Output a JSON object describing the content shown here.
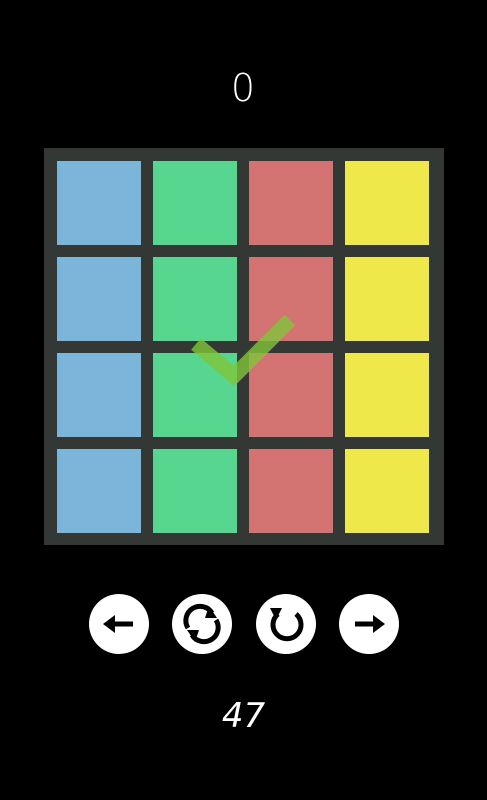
{
  "score": "0",
  "moves": "47",
  "colors": {
    "background": "#000000",
    "board": "#343834",
    "blue": "#7bb5d9",
    "green": "#57d68f",
    "red": "#d37372",
    "yellow": "#eee84a",
    "check": "#7fc63a"
  },
  "board": {
    "rows": [
      [
        "blue",
        "green",
        "red",
        "yellow"
      ],
      [
        "blue",
        "green",
        "red",
        "yellow"
      ],
      [
        "blue",
        "green",
        "red",
        "yellow"
      ],
      [
        "blue",
        "green",
        "red",
        "yellow"
      ]
    ],
    "solved_indicator": "checkmark-icon"
  },
  "controls": [
    {
      "name": "move-left-button",
      "icon": "arrow-left-icon"
    },
    {
      "name": "shuffle-button",
      "icon": "refresh-icon"
    },
    {
      "name": "undo-button",
      "icon": "undo-icon"
    },
    {
      "name": "move-right-button",
      "icon": "arrow-right-icon"
    }
  ]
}
